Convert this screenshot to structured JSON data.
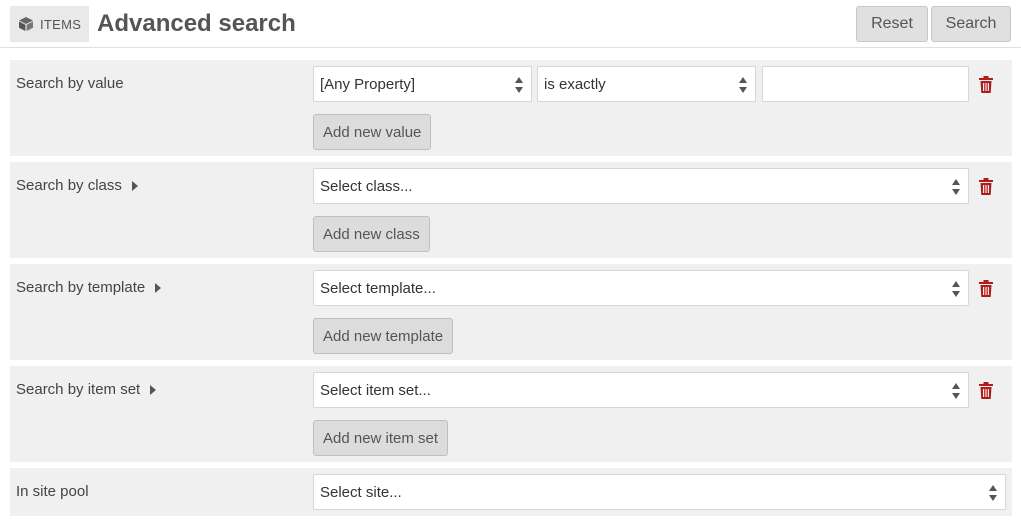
{
  "header": {
    "section_label": "ITEMS",
    "title": "Advanced search",
    "reset_label": "Reset",
    "search_label": "Search"
  },
  "fieldsets": {
    "value": {
      "label": "Search by value",
      "property_select": "[Any Property]",
      "operator_select": "is exactly",
      "text_value": "",
      "add_label": "Add new value"
    },
    "class": {
      "label": "Search by class",
      "select": "Select class...",
      "add_label": "Add new class"
    },
    "template": {
      "label": "Search by template",
      "select": "Select template...",
      "add_label": "Add new template"
    },
    "item_set": {
      "label": "Search by item set",
      "select": "Select item set...",
      "add_label": "Add new item set"
    },
    "site_pool": {
      "label": "In site pool",
      "select": "Select site..."
    }
  },
  "colors": {
    "delete_icon": "#b01b1b",
    "fieldset_bg": "#f0f0f0",
    "button_bg": "#dcdcdc"
  }
}
